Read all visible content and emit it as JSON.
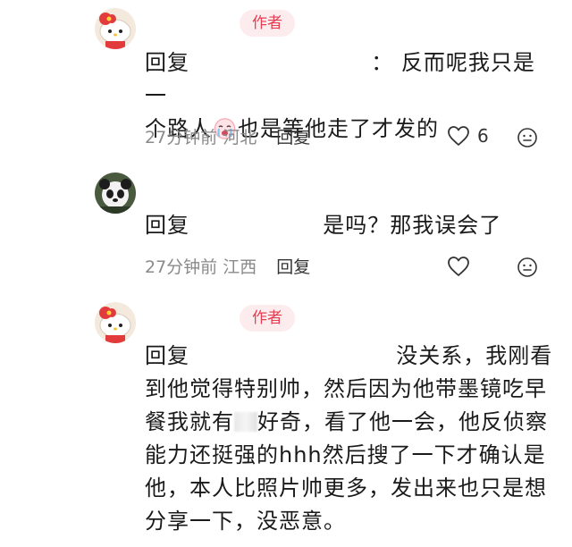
{
  "comments": [
    {
      "is_author": true,
      "author_badge": "作者",
      "reply_word": "回复",
      "reply_separator": "：",
      "text_line1": "反而呢我只是一",
      "text_line2_a": "个路人",
      "text_line2_b": "也是等他走了才发的",
      "time": "27分钟前",
      "location": "河北",
      "reply_label": "回复",
      "like_count": "6"
    },
    {
      "is_author": false,
      "reply_word": "回复",
      "text": "是吗？那我误会了",
      "time": "27分钟前",
      "location": "江西",
      "reply_label": "回复"
    },
    {
      "is_author": true,
      "author_badge": "作者",
      "reply_word": "回复",
      "text_line1": "没关系，我刚看",
      "text_line2": "到他觉得特别帅，然后因为他带墨镜吃早",
      "text_line3_a": "餐我就有",
      "text_line3_b": "好奇，看了他一会，他反侦察",
      "text_line4": "能力还挺强的hhh然后搜了一下才确认是",
      "text_line5": "他，本人比照片帅更多，发出来也只是想",
      "text_line6": "分享一下，没恶意。"
    }
  ],
  "colors": {
    "badge_bg": "#fdecee",
    "badge_text": "#e33e52",
    "meta_text": "#8a8a8a"
  },
  "icons": [
    "hello-kitty-avatar-icon",
    "panda-avatar-icon",
    "heart-icon",
    "emoji-smile-icon",
    "crying-emoji-icon"
  ]
}
